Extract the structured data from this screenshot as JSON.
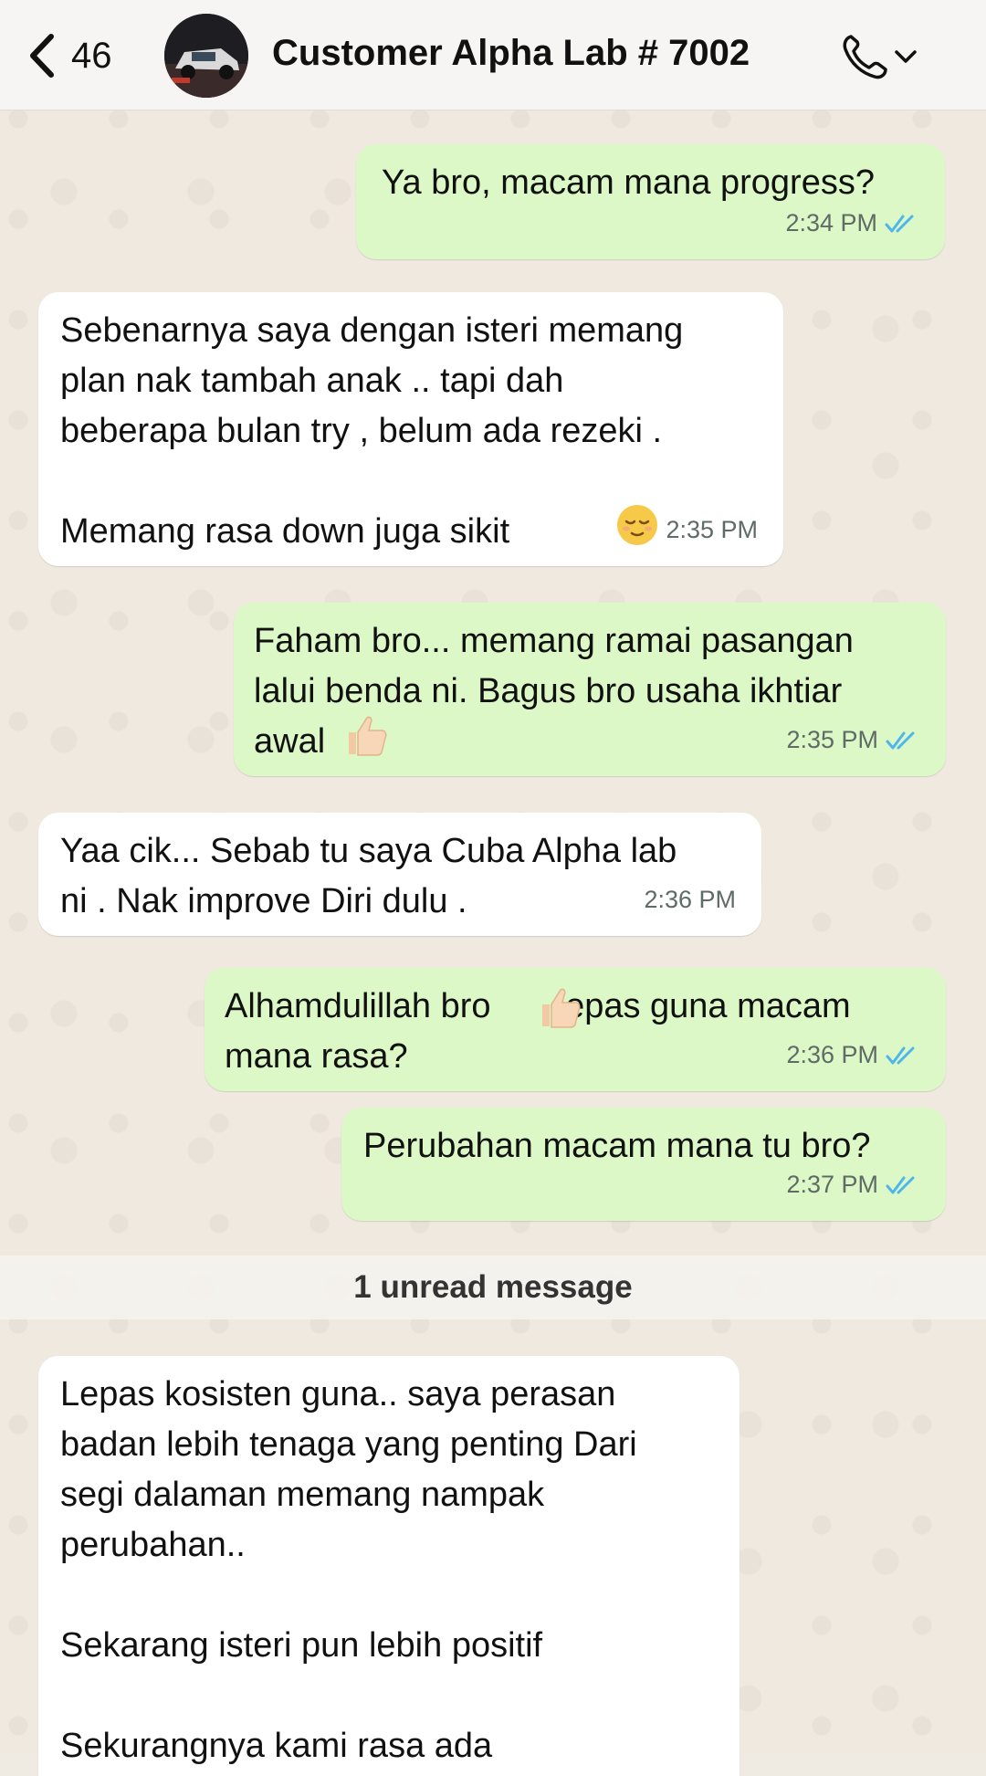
{
  "header": {
    "back_count": "46",
    "title": "Customer Alpha Lab # 7002"
  },
  "messages": [
    {
      "dir": "out",
      "text": "Ya bro, macam mana progress?",
      "time": "2:34 PM"
    },
    {
      "dir": "in",
      "text": "Sebenarnya saya dengan isteri memang\nplan nak tambah anak .. tapi dah\nbeberapa bulan try , belum ada rezeki .\n\nMemang rasa down juga sikit",
      "emoji": "relieved-face",
      "time": "2:35 PM"
    },
    {
      "dir": "out",
      "text": "Faham bro... memang ramai pasangan\nlalui benda ni. Bagus bro usaha ikhtiar\nawal",
      "emoji": "thumbs-up",
      "time": "2:35 PM"
    },
    {
      "dir": "in",
      "text": "Yaa cik... Sebab tu saya Cuba Alpha lab\nni . Nak improve Diri dulu .",
      "time": "2:36 PM"
    },
    {
      "dir": "out",
      "text_before": "Alhamdulillah bro",
      "emoji": "thumbs-up",
      "text_after": "lepas guna macam\nmana rasa?",
      "time": "2:36 PM"
    },
    {
      "dir": "out",
      "text": "Perubahan macam mana tu bro?",
      "time": "2:37 PM"
    },
    {
      "dir": "in",
      "text": "Lepas kosisten guna.. saya perasan\nbadan lebih tenaga yang penting Dari\nsegi dalaman memang nampak\nperubahan..\n\nSekarang isteri pun lebih positif\n\nSekurangnya kami rasa ada"
    }
  ],
  "unread_label": "1 unread message",
  "colors": {
    "outgoing_bubble": "#dcf8c6",
    "incoming_bubble": "#ffffff",
    "read_ticks": "#4fb6ec"
  }
}
